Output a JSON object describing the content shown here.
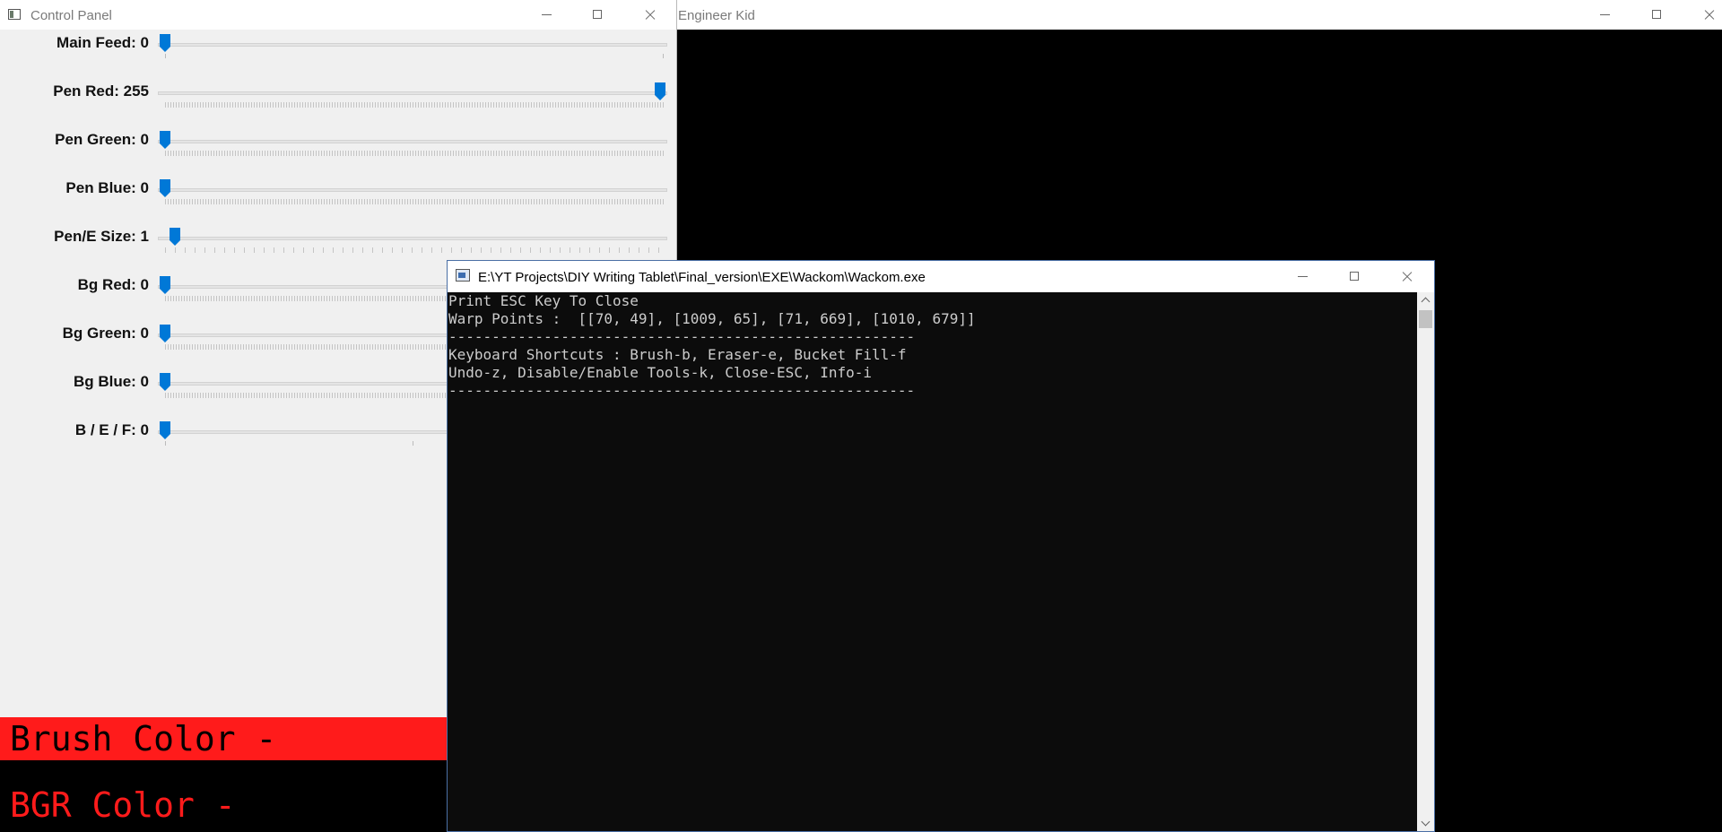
{
  "bg_window": {
    "title": "Engineer Kid"
  },
  "control_panel": {
    "title": "Control Panel",
    "sliders": [
      {
        "label": "Main Feed: 0",
        "value": 0,
        "max": 2,
        "ticks": "sparse"
      },
      {
        "label": "Pen Red: 255",
        "value": 255,
        "max": 255,
        "ticks": "dense"
      },
      {
        "label": "Pen Green: 0",
        "value": 0,
        "max": 255,
        "ticks": "dense"
      },
      {
        "label": "Pen Blue: 0",
        "value": 0,
        "max": 255,
        "ticks": "dense"
      },
      {
        "label": "Pen/E Size: 1",
        "value": 1,
        "max": 50,
        "ticks": "medium"
      },
      {
        "label": "Bg Red: 0",
        "value": 0,
        "max": 255,
        "ticks": "dense"
      },
      {
        "label": "Bg Green: 0",
        "value": 0,
        "max": 255,
        "ticks": "dense"
      },
      {
        "label": "Bg Blue: 0",
        "value": 0,
        "max": 255,
        "ticks": "dense"
      },
      {
        "label": "B / E / F: 0",
        "value": 0,
        "max": 2,
        "ticks": "sparse"
      }
    ],
    "brush_color_text": "Brush Color -",
    "bgr_color_text": "BGR Color -",
    "brush_color": "#ff1b1b"
  },
  "console": {
    "title": "E:\\YT Projects\\DIY Writing Tablet\\Final_version\\EXE\\Wackom\\Wackom.exe",
    "lines": [
      "Print ESC Key To Close",
      "Warp Points :  [[70, 49], [1009, 65], [71, 669], [1010, 679]]",
      "------------------------------------------------------",
      "Keyboard Shortcuts : Brush-b, Eraser-e, Bucket Fill-f",
      "Undo-z, Disable/Enable Tools-k, Close-ESC, Info-i",
      "------------------------------------------------------"
    ]
  },
  "colors": {
    "accent": "#0078d7",
    "console_bg": "#0c0c0c",
    "console_text": "#cccccc"
  }
}
